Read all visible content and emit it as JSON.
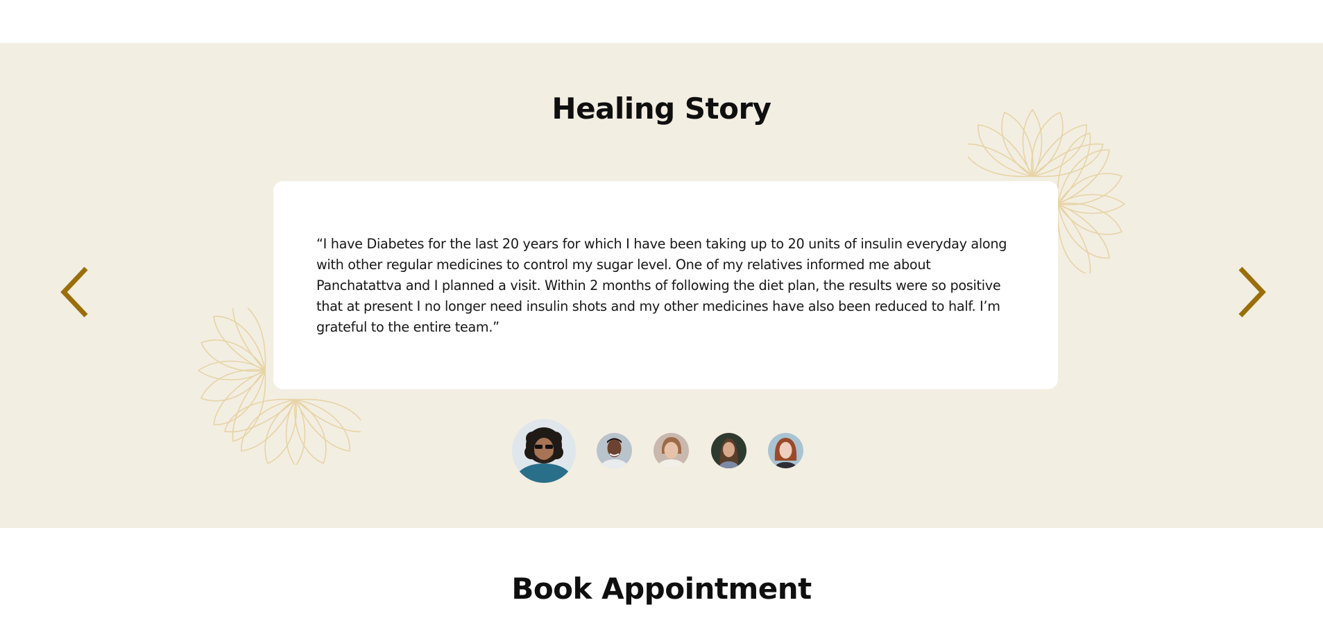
{
  "healing": {
    "title": "Healing Story",
    "testimonial": "“I have Diabetes for the last 20 years for which I have been taking up to 20 units of insulin everyday along with other regular medicines to control my sugar level. One of my relatives informed me about Panchatattva and I planned a visit. Within 2 months of following the diet plan, the results were so positive that at present I no longer need insulin shots and my other medicines have also been reduced to half. I’m grateful to the entire team.”",
    "prev_icon": "chevron-left-icon",
    "next_icon": "chevron-right-icon",
    "avatars": [
      {
        "icon": "avatar-photo",
        "selected": true
      },
      {
        "icon": "avatar-photo",
        "selected": false
      },
      {
        "icon": "avatar-photo",
        "selected": false
      },
      {
        "icon": "avatar-photo",
        "selected": false
      },
      {
        "icon": "avatar-photo",
        "selected": false
      }
    ]
  },
  "book": {
    "title": "Book Appointment"
  },
  "colors": {
    "band_background": "#f3eee2",
    "arrow": "#9a6f0b",
    "lotus_outline": "#e6d3a3",
    "card": "#ffffff"
  }
}
